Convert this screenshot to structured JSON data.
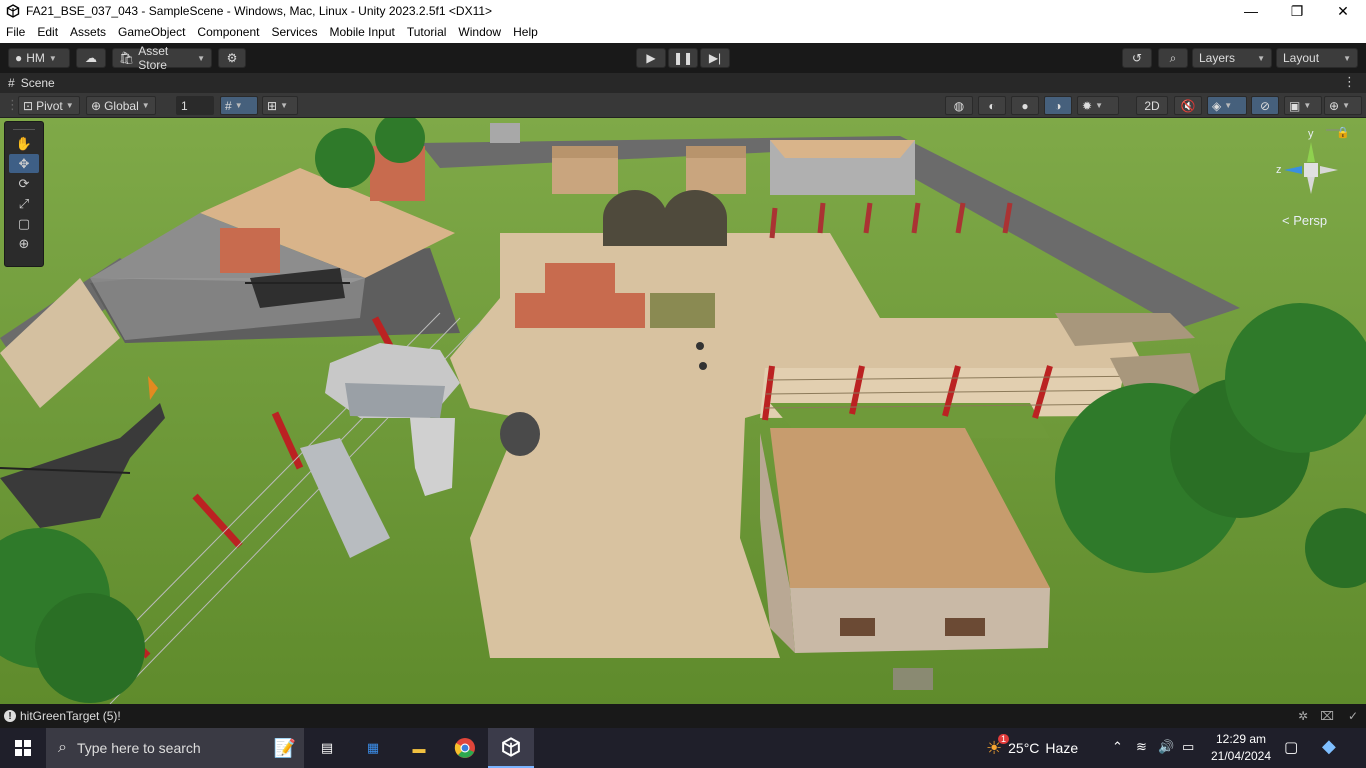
{
  "window": {
    "title": "FA21_BSE_037_043 - SampleScene - Windows, Mac, Linux - Unity 2023.2.5f1 <DX11>",
    "minimize_icon": "minimize-icon",
    "maximize_icon": "restore-icon",
    "close_icon": "close-icon"
  },
  "menu": [
    "File",
    "Edit",
    "Assets",
    "GameObject",
    "Component",
    "Services",
    "Mobile Input",
    "Tutorial",
    "Window",
    "Help"
  ],
  "toolbar": {
    "account": "HM",
    "asset_store": "Asset Store",
    "layers": "Layers",
    "layout": "Layout"
  },
  "scene_tab": {
    "label": "Scene"
  },
  "scene_toolbar": {
    "pivot": "Pivot",
    "global": "Global",
    "grid_size": "1",
    "mode_2d": "2D"
  },
  "gizmo": {
    "y_label": "y",
    "z_label": "z",
    "projection": "< Persp"
  },
  "status": {
    "message": "hitGreenTarget (5)!"
  },
  "taskbar": {
    "search_placeholder": "Type here to search",
    "weather_temp": "25°C",
    "weather_desc": "Haze",
    "time": "12:29 am",
    "date": "21/04/2024",
    "weather_badge": "1"
  },
  "colors": {
    "unity_dark": "#191919",
    "grass": "#6f9a3a",
    "ground": "#d8c2a0",
    "accent_blue": "#46607c"
  }
}
